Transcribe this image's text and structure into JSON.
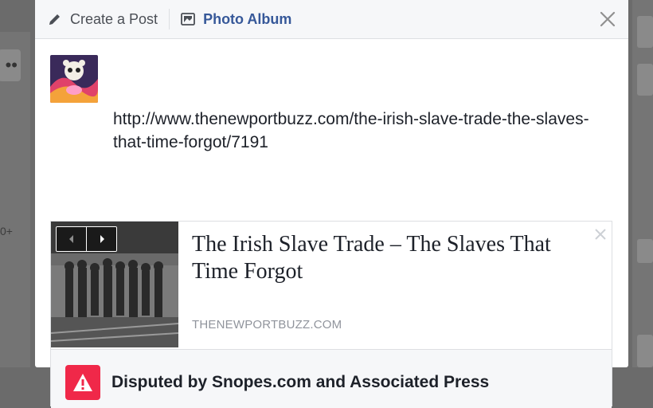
{
  "background": {
    "more_icon": "more-dots-icon",
    "count_fragment": "0+"
  },
  "header": {
    "create_post_label": "Create a Post",
    "photo_album_label": "Photo Album",
    "close_icon": "close-icon"
  },
  "composer": {
    "url_text": "http://www.thenewportbuzz.com/the-irish-slave-trade-the-slaves-that-time-forgot/7191"
  },
  "link_preview": {
    "title": "The Irish Slave Trade – The Slaves That Time Forgot",
    "domain": "THENEWPORTBUZZ.COM"
  },
  "disputed": {
    "text": "Disputed by Snopes.com and Associated Press"
  },
  "colors": {
    "link_blue": "#365899",
    "warning_red": "#f02849",
    "header_bg": "#f6f7f9"
  }
}
